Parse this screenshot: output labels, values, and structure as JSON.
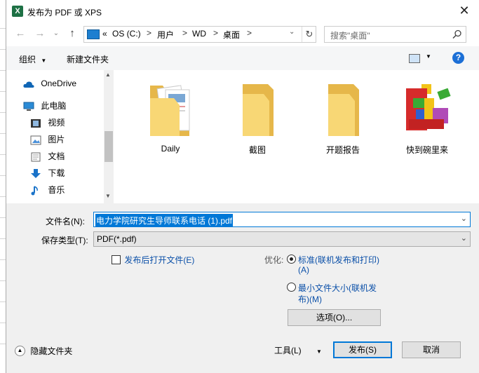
{
  "window": {
    "title": "发布为 PDF 或 XPS",
    "close_label": "✕"
  },
  "navigation": {
    "back_icon": "back-arrow-icon",
    "forward_icon": "forward-arrow-icon",
    "up_icon": "up-arrow-icon",
    "breadcrumb": [
      "«",
      "OS (C:)",
      "用户",
      "WD",
      "桌面"
    ],
    "search_placeholder": "搜索\"桌面\""
  },
  "toolbar": {
    "organize_label": "组织",
    "new_folder_label": "新建文件夹"
  },
  "sidebar": {
    "items": [
      {
        "label": "OneDrive",
        "icon": "cloud-icon"
      },
      {
        "label": "此电脑",
        "icon": "computer-icon"
      },
      {
        "label": "视频",
        "icon": "video-icon"
      },
      {
        "label": "图片",
        "icon": "picture-icon"
      },
      {
        "label": "文档",
        "icon": "document-icon"
      },
      {
        "label": "下载",
        "icon": "download-icon"
      },
      {
        "label": "音乐",
        "icon": "music-icon"
      }
    ]
  },
  "files": [
    {
      "name": "Daily",
      "icon": "folder-with-docs-icon"
    },
    {
      "name": "截图",
      "icon": "folder-icon"
    },
    {
      "name": "开题报告",
      "icon": "folder-icon"
    },
    {
      "name": "快到碗里来",
      "icon": "app-blocks-icon"
    }
  ],
  "form": {
    "filename_label": "文件名(N):",
    "filename_value": "电力学院研究生导师联系电话 (1).pdf",
    "filetype_label": "保存类型(T):",
    "filetype_value": "PDF(*.pdf)",
    "open_after_label": "发布后打开文件(E)",
    "optimize_label": "优化:",
    "option_standard_line1": "标准(联机发布和打印)",
    "option_standard_line2": "(A)",
    "option_min_line1": "最小文件大小(联机发",
    "option_min_line2": "布)(M)",
    "options_button": "选项(O)...",
    "hide_folders_label": "隐藏文件夹",
    "tools_label": "工具(L)",
    "publish_button": "发布(S)",
    "cancel_button": "取消"
  },
  "colors": {
    "accent": "#0078d7",
    "folder": "#f8d775",
    "link": "#0a4fa8"
  }
}
